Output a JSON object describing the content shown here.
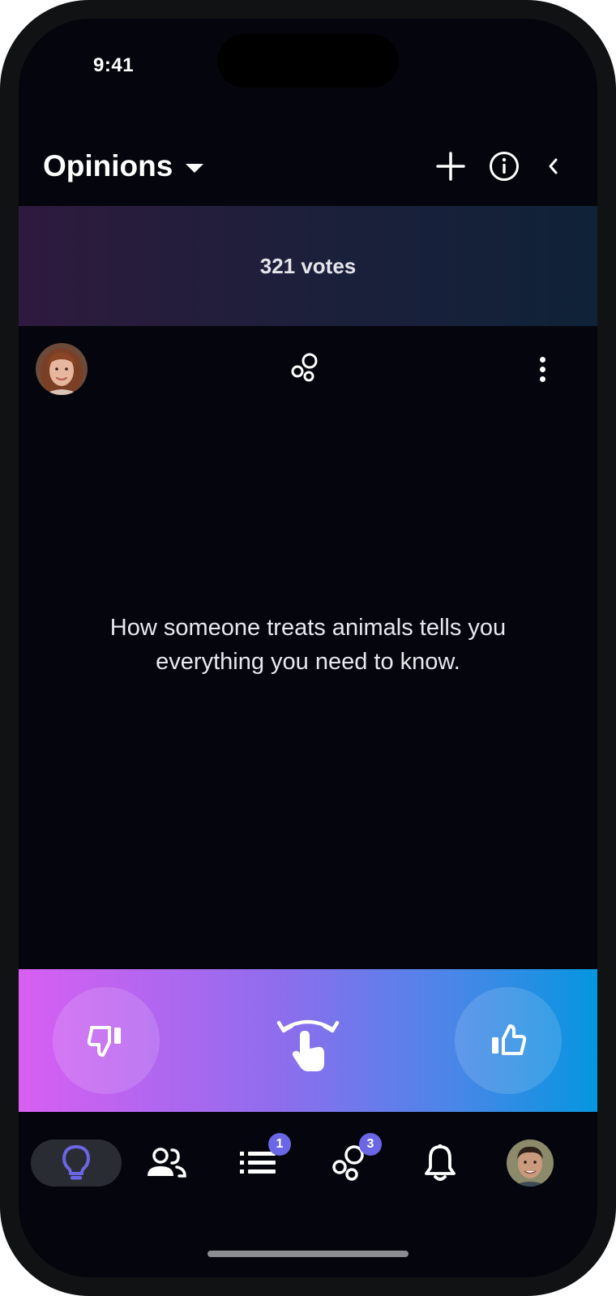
{
  "status_bar": {
    "time": "9:41"
  },
  "header": {
    "title": "Opinions",
    "icons": [
      "plus-icon",
      "info-icon",
      "chevron-left-icon"
    ]
  },
  "banner": {
    "votes_label": "321 votes"
  },
  "post": {
    "author_avatar": "avatar-woman",
    "statement": "How someone treats animals tells you everything you need to know."
  },
  "vote_bar": {
    "icons": [
      "thumbs-down-icon",
      "swipe-gesture-icon",
      "thumbs-up-icon"
    ]
  },
  "tabbar": {
    "tabs": [
      {
        "name": "ideas",
        "icon": "lightbulb-icon",
        "active": true
      },
      {
        "name": "people",
        "icon": "people-icon"
      },
      {
        "name": "lists",
        "icon": "list-icon",
        "badge": "1"
      },
      {
        "name": "circles",
        "icon": "bubbles-icon",
        "badge": "3"
      },
      {
        "name": "notifications",
        "icon": "bell-icon"
      },
      {
        "name": "profile",
        "icon": "avatar-man"
      }
    ]
  },
  "colors": {
    "background": "#05060d",
    "accent": "#6b66e6",
    "vote_gradient_start": "#d85ff2",
    "vote_gradient_end": "#0596df"
  }
}
